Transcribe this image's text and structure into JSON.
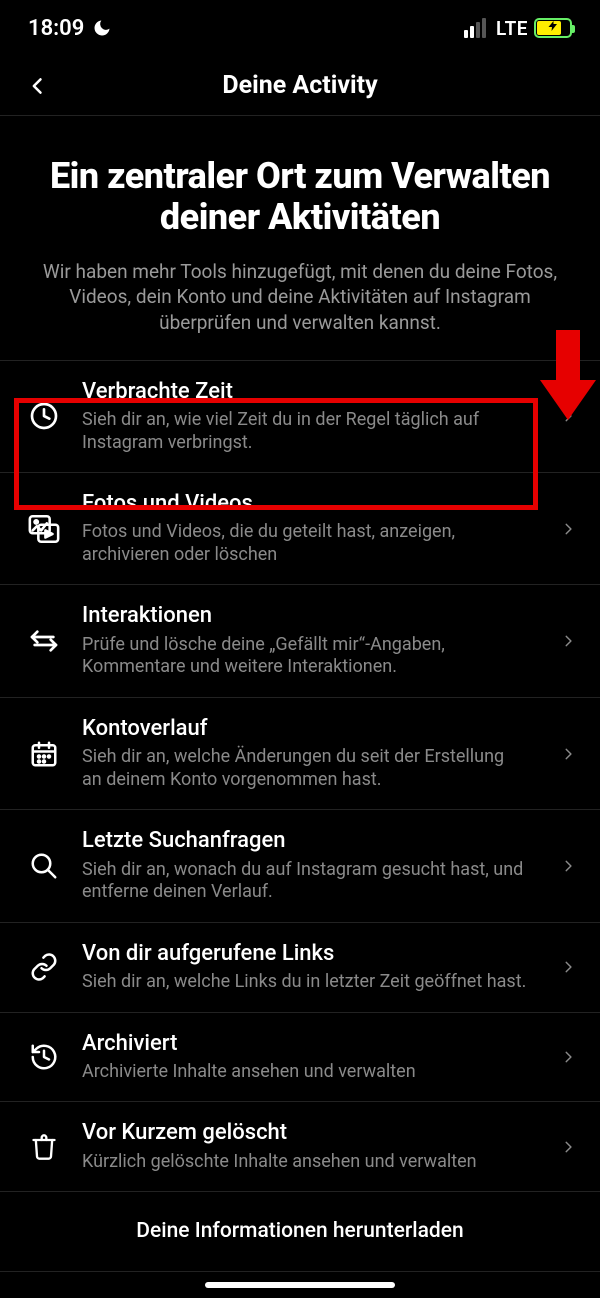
{
  "statusbar": {
    "time": "18:09",
    "network_label": "LTE"
  },
  "navbar": {
    "title": "Deine Activity"
  },
  "header": {
    "title": "Ein zentraler Ort zum Verwalten deiner Aktivitäten",
    "subtitle": "Wir haben mehr Tools hinzugefügt, mit denen du deine Fotos, Videos, dein Konto und deine Aktivitäten auf Instagram überprüfen und verwalten kannst."
  },
  "rows": [
    {
      "title": "Verbrachte Zeit",
      "desc": "Sieh dir an, wie viel Zeit du in der Regel täglich auf Instagram verbringst."
    },
    {
      "title": "Fotos und Videos",
      "desc": "Fotos und Videos, die du geteilt hast, anzeigen, archivieren oder löschen"
    },
    {
      "title": "Interaktionen",
      "desc": "Prüfe und lösche deine „Gefällt mir“-Angaben, Kommentare und weitere Interaktionen."
    },
    {
      "title": "Kontoverlauf",
      "desc": "Sieh dir an, welche Änderungen du seit der Erstellung an deinem Konto vorgenommen hast."
    },
    {
      "title": "Letzte Suchanfragen",
      "desc": "Sieh dir an, wonach du auf Instagram gesucht hast, und entferne deinen Verlauf."
    },
    {
      "title": "Von dir aufgerufene Links",
      "desc": "Sieh dir an, welche Links du in letzter Zeit geöffnet hast."
    },
    {
      "title": "Archiviert",
      "desc": "Archivierte Inhalte ansehen und verwalten"
    },
    {
      "title": "Vor Kurzem gelöscht",
      "desc": "Kürzlich gelöschte Inhalte ansehen und verwalten"
    }
  ],
  "footer": {
    "download_label": "Deine Informationen herunterladen"
  }
}
